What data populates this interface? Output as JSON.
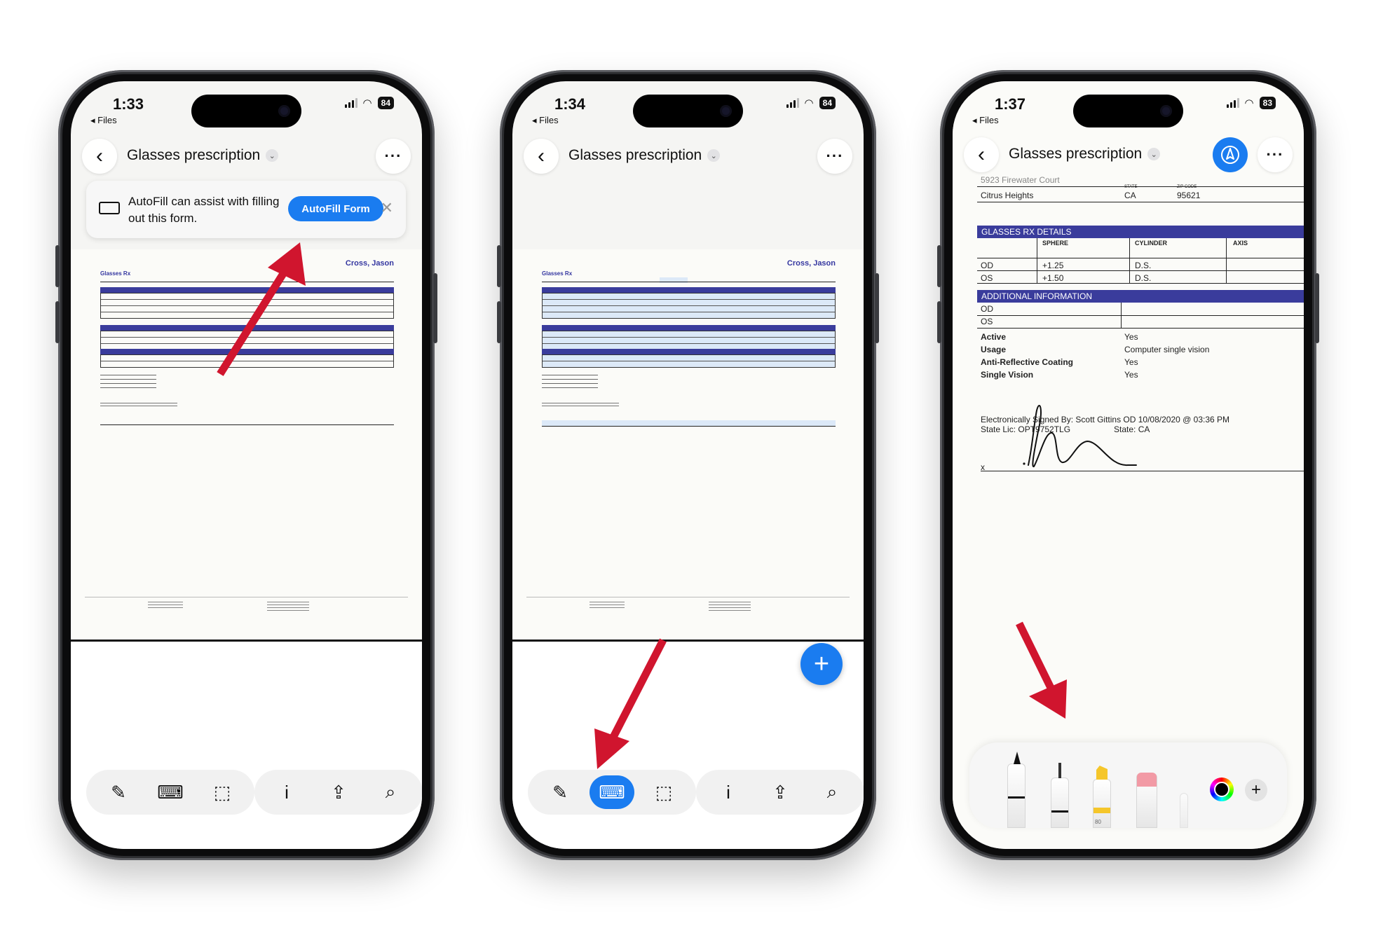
{
  "phones": [
    {
      "status": {
        "time": "1:33",
        "back": "◂ Files",
        "battery": "84"
      },
      "nav": {
        "title": "Glasses prescription"
      },
      "autofill": {
        "message": "AutoFill can assist with filling out this form.",
        "button": "AutoFill Form"
      },
      "doc": {
        "name": "Cross, Jason",
        "rx_title": "Glasses Rx"
      }
    },
    {
      "status": {
        "time": "1:34",
        "back": "◂ Files",
        "battery": "84"
      },
      "nav": {
        "title": "Glasses prescription"
      },
      "doc": {
        "name": "Cross, Jason",
        "rx_title": "Glasses Rx"
      }
    },
    {
      "status": {
        "time": "1:37",
        "back": "◂ Files",
        "battery": "83"
      },
      "nav": {
        "title": "Glasses prescription"
      },
      "zoomed": {
        "address": "5923 Firewater Court",
        "city": "Citrus Heights",
        "state": "CA",
        "zip": "95621",
        "state_label": "STATE",
        "zip_label": "ZIP CODE",
        "rx_header": "GLASSES RX DETAILS",
        "col_sphere": "SPHERE",
        "col_cylinder": "CYLINDER",
        "col_axis": "AXIS",
        "od_label": "OD",
        "os_label": "OS",
        "od_sphere": "+1.25",
        "os_sphere": "+1.50",
        "od_cyl": "D.S.",
        "os_cyl": "D.S.",
        "add_header": "ADDITIONAL INFORMATION",
        "add_od": "OD",
        "add_os": "OS",
        "rows": [
          {
            "label": "Active",
            "value": "Yes"
          },
          {
            "label": "Usage",
            "value": "Computer single vision"
          },
          {
            "label": "Anti-Reflective Coating",
            "value": "Yes"
          },
          {
            "label": "Single Vision",
            "value": "Yes"
          }
        ],
        "signed_by": "Electronically Signed By: Scott Gittins OD 10/08/2020 @ 03:36 PM",
        "state_lic": "State Lic: OPT9752TLG",
        "state_lic_state": "State: CA",
        "sig_x": "x"
      },
      "palette": {
        "opacity": "80"
      }
    }
  ],
  "accent": "#1a7cf0",
  "arrow_color": "#d0152e",
  "doc_section_color": "#3a3c9c"
}
